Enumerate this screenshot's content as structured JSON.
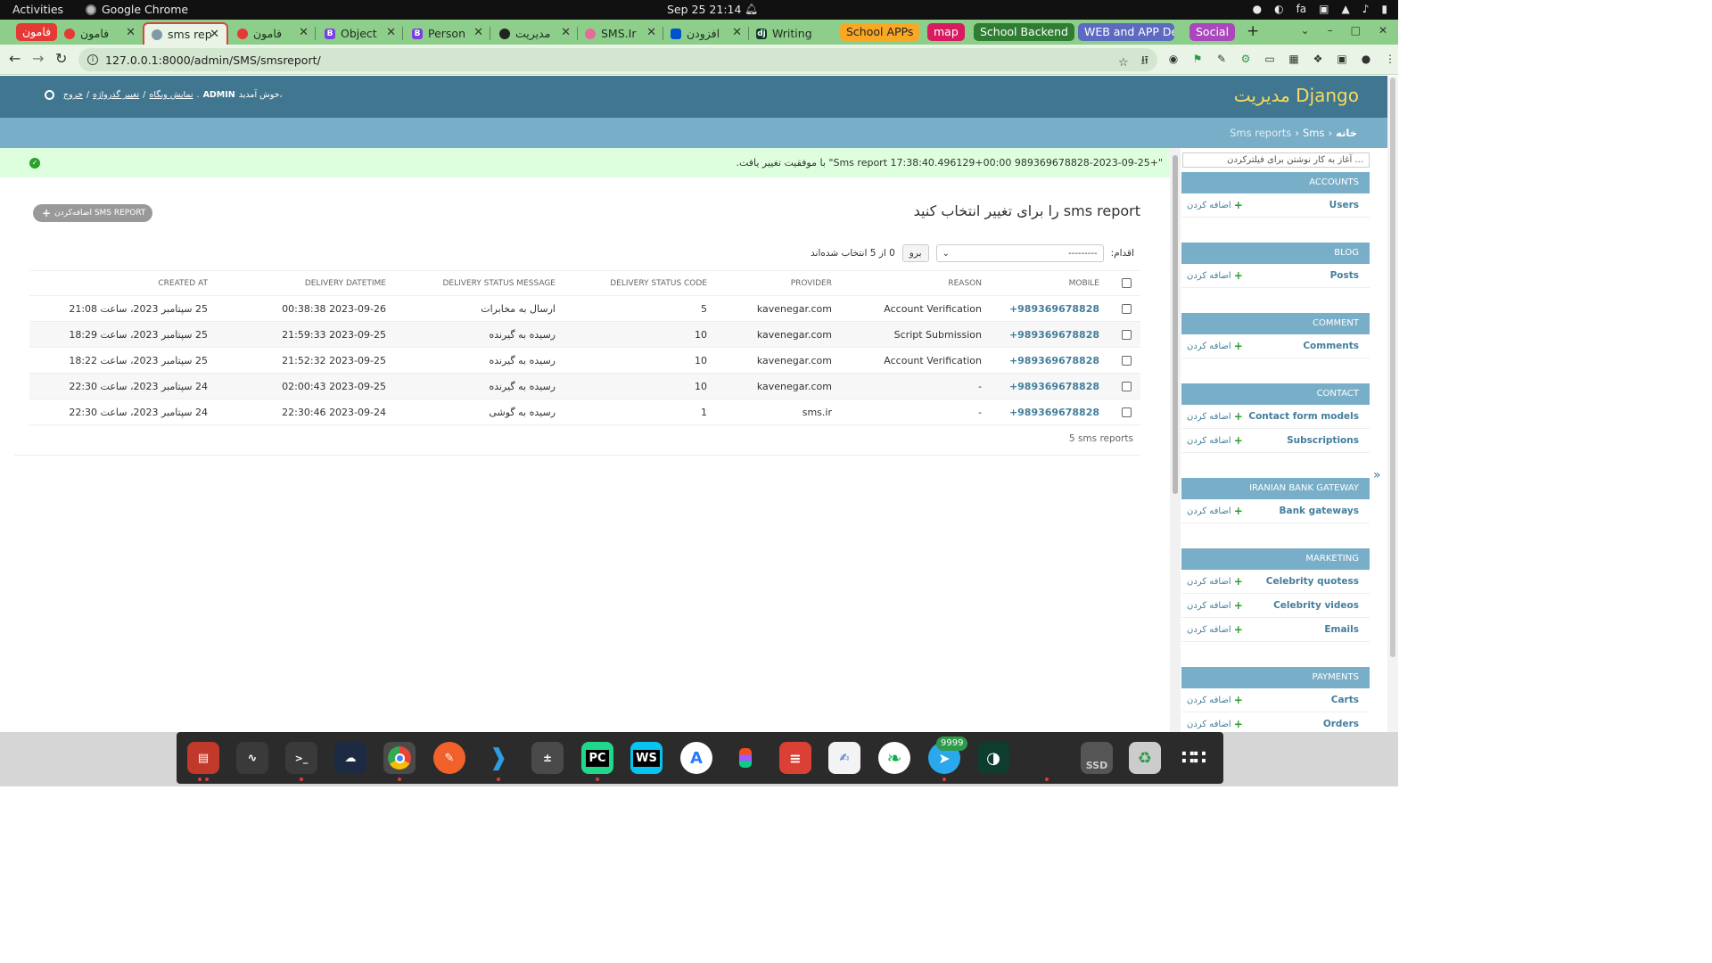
{
  "system": {
    "activities": "Activities",
    "app_name": "Google Chrome",
    "clock": "Sep 25  21:14",
    "input_lang": "fa"
  },
  "browser": {
    "tabs": [
      {
        "label": "فامون",
        "x": 0
      },
      {
        "label": "sms rep"
      },
      {
        "label": "فامون"
      },
      {
        "label": "Object"
      },
      {
        "label": "Person"
      },
      {
        "label": "مدیریت"
      },
      {
        "label": "SMS.Ir"
      },
      {
        "label": "افزودن"
      },
      {
        "label": "Writing"
      }
    ],
    "groups": [
      {
        "label": "فامون",
        "color": "#e53935"
      },
      {
        "label": "School APPs",
        "color": "#f9a825"
      },
      {
        "label": "map",
        "color": "#d81b60"
      },
      {
        "label": "School Backend",
        "color": "#2e7d32"
      },
      {
        "label": "WEB and APP De",
        "color": "#5c6bc0"
      },
      {
        "label": "Social",
        "color": "#ab47bc"
      }
    ],
    "url": "127.0.0.1:8000/admin/SMS/smsreport/"
  },
  "admin": {
    "brand": "مدیریت Django",
    "welcome": "خوش آمدید،",
    "username": "ADMIN",
    "view_site": "نمایش وبگاه",
    "change_password": "تغییر گذرواژه",
    "logout": "خروج",
    "breadcrumbs": [
      "خانه",
      "Sms",
      "Sms reports"
    ],
    "message": "\"+989369678828-2023-09-25 17:38:40.496129+00:00 Sms report\" با موفقیت تغییر یافت.",
    "page_title": "sms report را برای تغییر انتخاب کنید",
    "add_button": "اضافه‌کردن SMS REPORT",
    "action_label": "اقدام:",
    "action_default": "---------",
    "go_label": "برو",
    "selected_counter": "0 از 5 انتخاب شده‌اند",
    "columns": [
      "MOBILE",
      "REASON",
      "PROVIDER",
      "DELIVERY STATUS CODE",
      "DELIVERY STATUS MESSAGE",
      "DELIVERY DATETIME",
      "CREATED AT"
    ],
    "rows": [
      {
        "mobile": "+989369678828",
        "reason": "Account Verification",
        "provider": "kavenegar.com",
        "code": "5",
        "message": "ارسال به مخابرات",
        "delivery": "2023-09-26 00:38:38",
        "created": "25 سپتامبر 2023، ساعت 21:08"
      },
      {
        "mobile": "+989369678828",
        "reason": "Script Submission",
        "provider": "kavenegar.com",
        "code": "10",
        "message": "رسیده به گیرنده",
        "delivery": "2023-09-25 21:59:33",
        "created": "25 سپتامبر 2023، ساعت 18:29"
      },
      {
        "mobile": "+989369678828",
        "reason": "Account Verification",
        "provider": "kavenegar.com",
        "code": "10",
        "message": "رسیده به گیرنده",
        "delivery": "2023-09-25 21:52:32",
        "created": "25 سپتامبر 2023، ساعت 18:22"
      },
      {
        "mobile": "+989369678828",
        "reason": "-",
        "provider": "kavenegar.com",
        "code": "10",
        "message": "رسیده به گیرنده",
        "delivery": "2023-09-25 02:00:43",
        "created": "24 سپتامبر 2023، ساعت 22:30"
      },
      {
        "mobile": "+989369678828",
        "reason": "-",
        "provider": "sms.ir",
        "code": "1",
        "message": "رسیده به گوشی",
        "delivery": "2023-09-24 22:30:46",
        "created": "24 سپتامبر 2023، ساعت 22:30"
      }
    ],
    "result_count": "5 sms reports",
    "filter_placeholder": "آغاز به کار نوشتن برای فیلترکردن ...",
    "add_link": "اضافه کردن",
    "modules": [
      {
        "caption": "ACCOUNTS",
        "items": [
          "Users"
        ]
      },
      {
        "caption": "BLOG",
        "items": [
          "Posts"
        ]
      },
      {
        "caption": "COMMENT",
        "items": [
          "Comments"
        ]
      },
      {
        "caption": "CONTACT",
        "items": [
          "Contact form models",
          "Subscriptions"
        ]
      },
      {
        "caption": "IRANIAN BANK GATEWAY",
        "items": [
          "Bank gateways"
        ]
      },
      {
        "caption": "MARKETING",
        "items": [
          "Celebrity quotess",
          "Celebrity videos",
          "Emails"
        ]
      },
      {
        "caption": "PAYMENTS",
        "items": [
          "Carts",
          "Orders"
        ]
      }
    ]
  },
  "dock": {
    "telegram_badge": "9999",
    "terminal_prompt": ">_",
    "pycharm_label": "PC",
    "webstorm_label": "WS",
    "ssd_label": "SSD"
  }
}
